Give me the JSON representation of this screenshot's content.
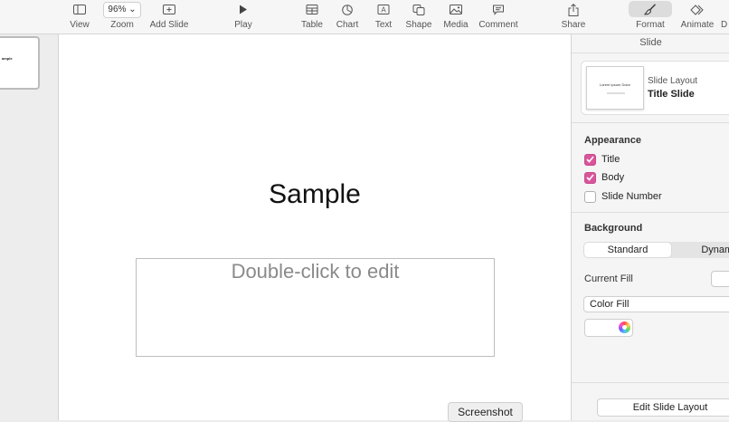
{
  "toolbar": {
    "view_label": "View",
    "zoom_value": "96%",
    "zoom_label": "Zoom",
    "add_slide_label": "Add Slide",
    "play_label": "Play",
    "table_label": "Table",
    "chart_label": "Chart",
    "text_label": "Text",
    "shape_label": "Shape",
    "media_label": "Media",
    "comment_label": "Comment",
    "share_label": "Share",
    "format_label": "Format",
    "animate_label": "Animate",
    "document_label": "D"
  },
  "navigator": {
    "thumb_text": "ample"
  },
  "slide": {
    "title": "Sample",
    "body_placeholder": "Double-click to edit"
  },
  "tooltip": {
    "screenshot": "Screenshot"
  },
  "inspector": {
    "header": "Slide",
    "layout_caption": "Slide Layout",
    "layout_name": "Title Slide",
    "layout_thumb_title": "Lorem Ipsum Dolor",
    "appearance_label": "Appearance",
    "checkboxes": [
      {
        "label": "Title",
        "checked": true
      },
      {
        "label": "Body",
        "checked": true
      },
      {
        "label": "Slide Number",
        "checked": false
      }
    ],
    "background_label": "Background",
    "segments": [
      "Standard",
      "Dynami"
    ],
    "current_fill_label": "Current Fill",
    "fill_type": "Color Fill",
    "edit_layout_button": "Edit Slide Layout"
  },
  "colors": {
    "checkbox_accent": "#d9559b"
  }
}
